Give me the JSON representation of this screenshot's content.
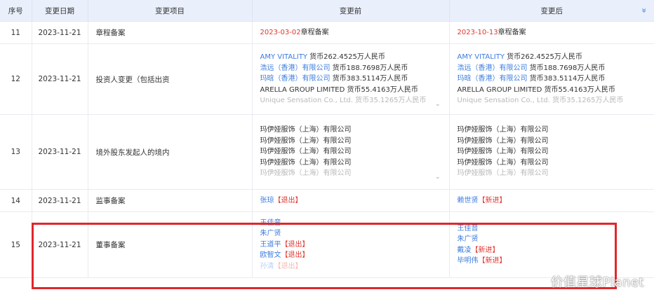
{
  "headers": [
    "序号",
    "变更日期",
    "变更项目",
    "变更前",
    "变更后"
  ],
  "rows": [
    {
      "num": "11",
      "date": "2023-11-21",
      "item": "章程备案",
      "before": [
        {
          "parts": [
            {
              "t": "2023-03-02",
              "c": "red"
            },
            {
              "t": "章程备案",
              "c": ""
            }
          ]
        }
      ],
      "after": [
        {
          "parts": [
            {
              "t": "2023-10-13",
              "c": "red"
            },
            {
              "t": "章程备案",
              "c": ""
            }
          ]
        }
      ]
    },
    {
      "num": "12",
      "date": "2023-11-21",
      "item": "投资人变更（包括出资",
      "before": [
        {
          "parts": [
            {
              "t": "AMY VITALITY",
              "c": "link"
            },
            {
              "t": " 货币262.4525万人民币",
              "c": ""
            }
          ]
        },
        {
          "parts": [
            {
              "t": "浩远（香港）有限公司",
              "c": "link"
            },
            {
              "t": " 货币188.7698万人民币",
              "c": ""
            }
          ]
        },
        {
          "parts": [
            {
              "t": "玛晗（香港）有限公司",
              "c": "link"
            },
            {
              "t": " 货币383.5114万人民币",
              "c": ""
            }
          ]
        },
        {
          "parts": [
            {
              "t": "ARELLA GROUP LIMITED 货币55.4163万人民币",
              "c": ""
            }
          ]
        },
        {
          "parts": [
            {
              "t": "Unique Sensation Co., Ltd. 货币35.1265万人民币",
              "c": ""
            }
          ],
          "faded": true
        }
      ],
      "after": [
        {
          "parts": [
            {
              "t": "AMY VITALITY",
              "c": "link"
            },
            {
              "t": " 货币262.4525万人民币",
              "c": ""
            }
          ]
        },
        {
          "parts": [
            {
              "t": "浩远（香港）有限公司",
              "c": "link"
            },
            {
              "t": " 货币188.7698万人民币",
              "c": ""
            }
          ]
        },
        {
          "parts": [
            {
              "t": "玛晗（香港）有限公司",
              "c": "link"
            },
            {
              "t": " 货币383.5114万人民币",
              "c": ""
            }
          ]
        },
        {
          "parts": [
            {
              "t": "ARELLA GROUP LIMITED 货币55.4163万人民币",
              "c": ""
            }
          ]
        },
        {
          "parts": [
            {
              "t": "Unique Sensation Co., Ltd. 货币35.1265万人民币",
              "c": ""
            }
          ],
          "faded": true
        }
      ]
    },
    {
      "num": "13",
      "date": "2023-11-21",
      "item": "境外股东发起人的境内",
      "before": [
        {
          "parts": [
            {
              "t": "玛伊娅服饰（上海）有限公司",
              "c": ""
            }
          ]
        },
        {
          "parts": [
            {
              "t": "玛伊娅服饰（上海）有限公司",
              "c": ""
            }
          ]
        },
        {
          "parts": [
            {
              "t": "玛伊娅服饰（上海）有限公司",
              "c": ""
            }
          ]
        },
        {
          "parts": [
            {
              "t": "玛伊娅服饰（上海）有限公司",
              "c": ""
            }
          ]
        },
        {
          "parts": [
            {
              "t": "玛伊娅服饰（上海）有限公司",
              "c": ""
            }
          ],
          "faded": true
        }
      ],
      "after": [
        {
          "parts": [
            {
              "t": "玛伊娅服饰（上海）有限公司",
              "c": ""
            }
          ]
        },
        {
          "parts": [
            {
              "t": "玛伊娅服饰（上海）有限公司",
              "c": ""
            }
          ]
        },
        {
          "parts": [
            {
              "t": "玛伊娅服饰（上海）有限公司",
              "c": ""
            }
          ]
        },
        {
          "parts": [
            {
              "t": "玛伊娅服饰（上海）有限公司",
              "c": ""
            }
          ]
        },
        {
          "parts": [
            {
              "t": "玛伊娅服饰（上海）有限公司",
              "c": ""
            }
          ],
          "faded": true
        }
      ]
    },
    {
      "num": "14",
      "date": "2023-11-21",
      "item": "监事备案",
      "before": [
        {
          "parts": [
            {
              "t": "张琼",
              "c": "link"
            },
            {
              "t": "【退出】",
              "c": "red"
            }
          ]
        }
      ],
      "after": [
        {
          "parts": [
            {
              "t": "赖世贤",
              "c": "link"
            },
            {
              "t": "【新进】",
              "c": "red"
            }
          ]
        }
      ]
    },
    {
      "num": "15",
      "date": "2023-11-21",
      "item": "董事备案",
      "before": [
        {
          "parts": [
            {
              "t": "王佳音",
              "c": "link"
            }
          ]
        },
        {
          "parts": [
            {
              "t": "朱广贤",
              "c": "link"
            }
          ]
        },
        {
          "parts": [
            {
              "t": "王道平",
              "c": "link"
            },
            {
              "t": "【退出】",
              "c": "red"
            }
          ]
        },
        {
          "parts": [
            {
              "t": "欧智文",
              "c": "link"
            },
            {
              "t": "【退出】",
              "c": "red"
            }
          ]
        },
        {
          "parts": [
            {
              "t": "孙清",
              "c": "link"
            },
            {
              "t": "【退出】",
              "c": "red"
            }
          ],
          "faded": true
        }
      ],
      "after": [
        {
          "parts": [
            {
              "t": "王佳音",
              "c": "link"
            }
          ]
        },
        {
          "parts": [
            {
              "t": "朱广贤",
              "c": "link"
            }
          ]
        },
        {
          "parts": [
            {
              "t": "戴凌",
              "c": "link"
            },
            {
              "t": "【新进】",
              "c": "red"
            }
          ]
        },
        {
          "parts": [
            {
              "t": "毕明伟",
              "c": "link"
            },
            {
              "t": "【新进】",
              "c": "red"
            }
          ]
        }
      ]
    }
  ],
  "expand_icon": "chevron-double-down-icon",
  "expand_glyph": "»",
  "more_glyph": "⌄",
  "watermark": "价值星球Planet"
}
